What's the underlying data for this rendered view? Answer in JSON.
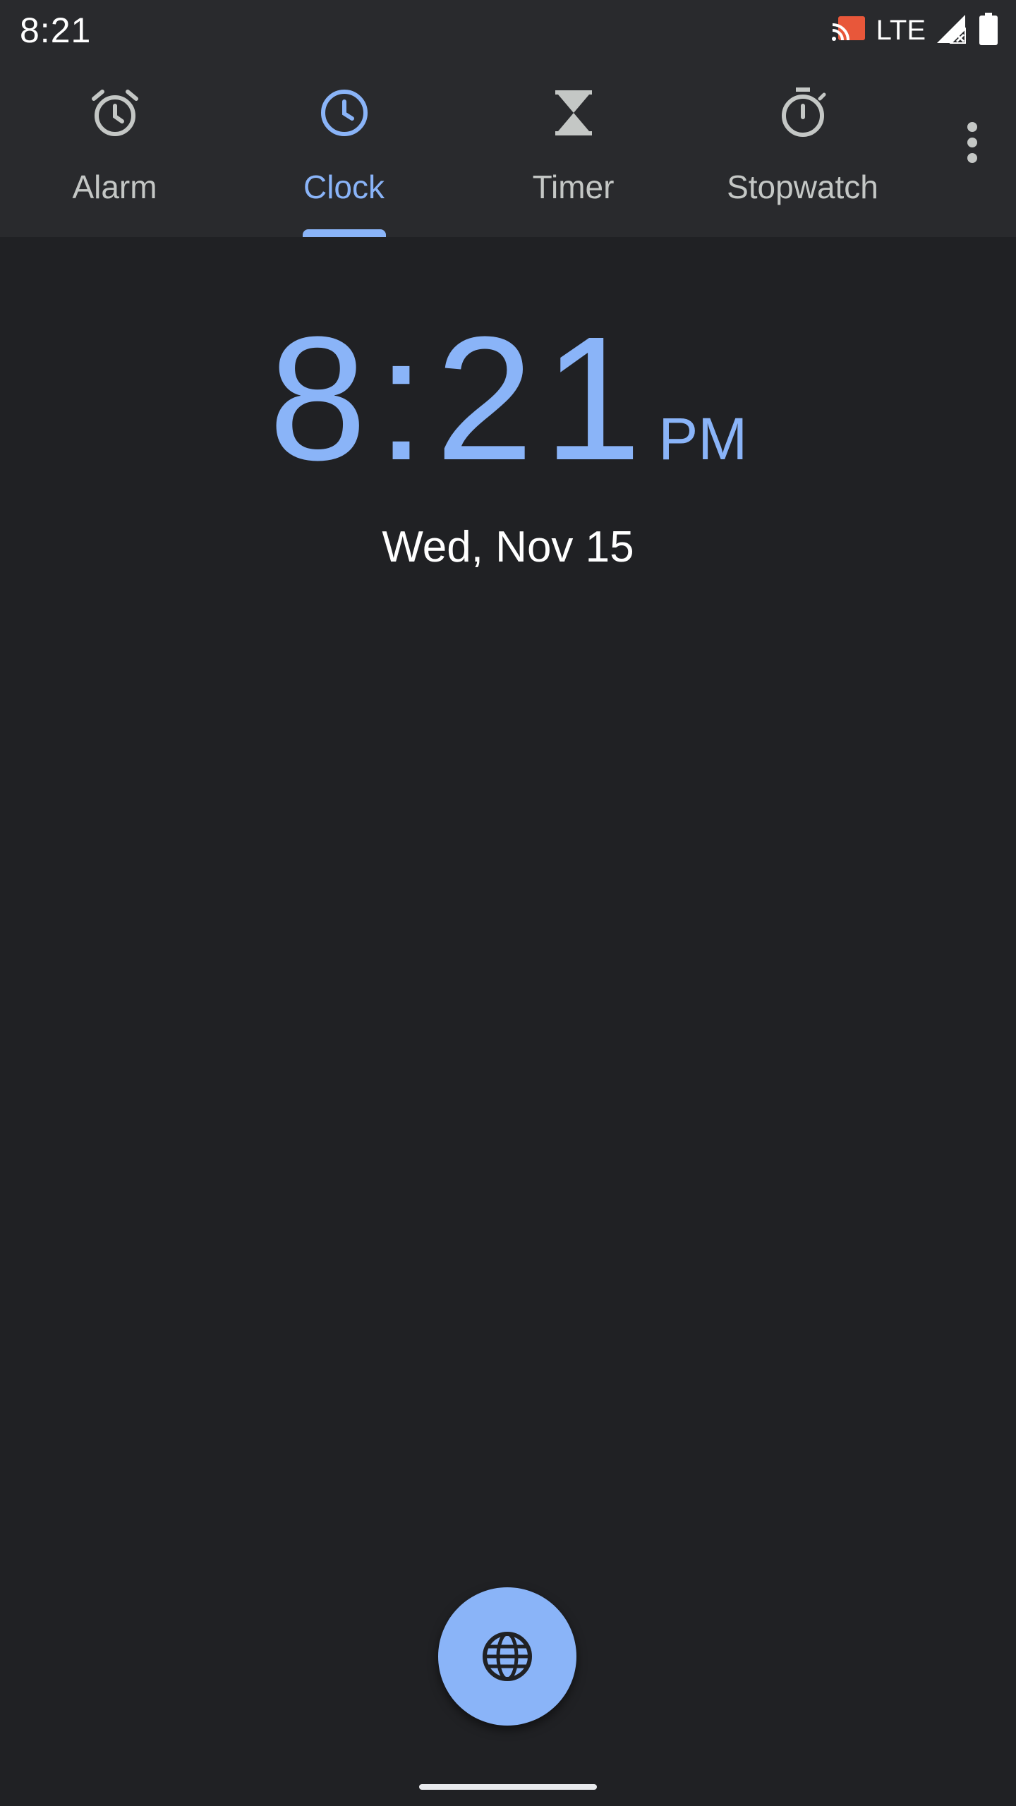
{
  "status_bar": {
    "time": "8:21",
    "network": "LTE",
    "icons": [
      "cast-icon",
      "signal-icon",
      "battery-icon"
    ],
    "cast_color": "#e8573a"
  },
  "tabs": [
    {
      "label": "Alarm",
      "icon": "alarm-icon",
      "active": false
    },
    {
      "label": "Clock",
      "icon": "clock-icon",
      "active": true
    },
    {
      "label": "Timer",
      "icon": "hourglass-icon",
      "active": false
    },
    {
      "label": "Stopwatch",
      "icon": "stopwatch-icon",
      "active": false
    }
  ],
  "menu_icon": "more-vert-icon",
  "clock": {
    "time": "8:21",
    "ampm": "PM",
    "date": "Wed, Nov 15"
  },
  "fab": {
    "icon": "globe-icon"
  },
  "colors": {
    "accent": "#8ab4f8",
    "background": "#202124",
    "bar_background": "#292a2d",
    "inactive_text": "#c4c7c5"
  }
}
